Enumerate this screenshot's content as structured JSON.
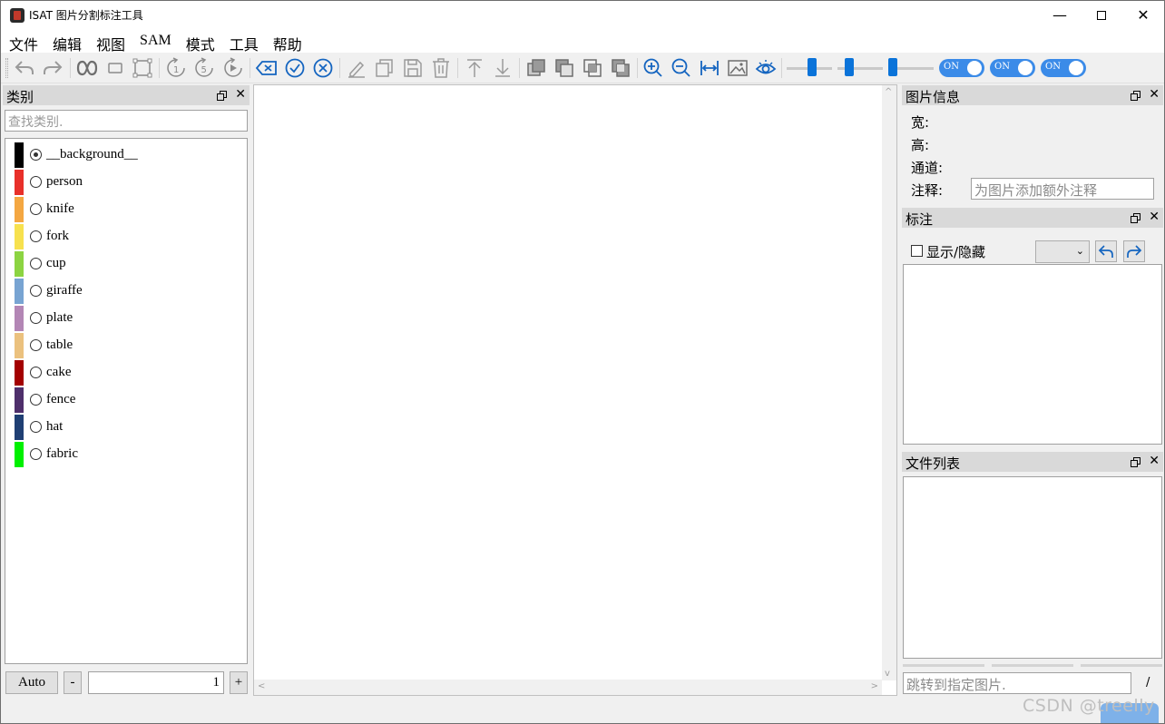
{
  "window": {
    "title": "ISAT 图片分割标注工具"
  },
  "menu": {
    "items": [
      "文件",
      "编辑",
      "视图",
      "SAM",
      "模式",
      "工具",
      "帮助"
    ]
  },
  "toolbar": {
    "icons": [
      "undo-icon",
      "redo-icon",
      "sam-infinity-icon",
      "rectangle-icon",
      "bounding-box-icon",
      "rotate-1-icon",
      "rotate-5-icon",
      "play-rotate-icon",
      "clear-icon",
      "finish-icon",
      "cancel-icon",
      "edit-icon",
      "copy-icon",
      "save-icon",
      "delete-icon",
      "move-top-icon",
      "move-bottom-icon",
      "layer-icon-1",
      "layer-icon-2",
      "layer-icon-3",
      "layer-icon-4",
      "zoom-in-icon",
      "zoom-out-icon",
      "fit-width-icon",
      "image-icon",
      "eye-icon"
    ],
    "toggles": [
      "ON",
      "ON",
      "ON"
    ],
    "accent": "#0a73d9"
  },
  "category_panel": {
    "title": "类别",
    "search_placeholder": "查找类别.",
    "items": [
      {
        "label": "__background__",
        "color": "#000000",
        "checked": true
      },
      {
        "label": "person",
        "color": "#e8302a",
        "checked": false
      },
      {
        "label": "knife",
        "color": "#f4a742",
        "checked": false
      },
      {
        "label": "fork",
        "color": "#f7e14e",
        "checked": false
      },
      {
        "label": "cup",
        "color": "#8cd442",
        "checked": false
      },
      {
        "label": "giraffe",
        "color": "#78a4d2",
        "checked": false
      },
      {
        "label": "plate",
        "color": "#b386b5",
        "checked": false
      },
      {
        "label": "table",
        "color": "#ebc17e",
        "checked": false
      },
      {
        "label": "cake",
        "color": "#a30000",
        "checked": false
      },
      {
        "label": "fence",
        "color": "#4e2f6b",
        "checked": false
      },
      {
        "label": "hat",
        "color": "#1f3f73",
        "checked": false
      },
      {
        "label": "fabric",
        "color": "#00f000",
        "checked": false
      }
    ],
    "auto_button": "Auto",
    "minus_button": "-",
    "plus_button": "+",
    "spin_value": "1"
  },
  "image_info": {
    "title": "图片信息",
    "width_label": "宽:",
    "height_label": "高:",
    "channel_label": "通道:",
    "note_label": "注释:",
    "note_placeholder": "为图片添加额外注释"
  },
  "annotation_panel": {
    "title": "标注",
    "show_hide_label": "显示/隐藏"
  },
  "file_panel": {
    "title": "文件列表",
    "jump_placeholder": "跳转到指定图片.",
    "page_separator": "/"
  },
  "watermark": "CSDN @treelly"
}
